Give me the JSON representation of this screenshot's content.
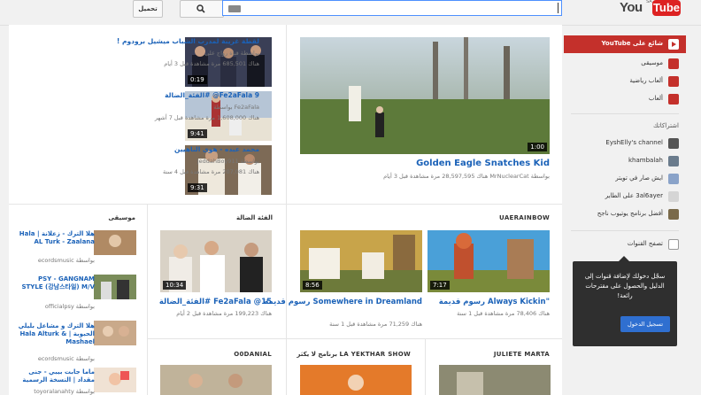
{
  "header": {
    "upload_label": "تحميل",
    "search_value": "",
    "logo_you": "You",
    "logo_tube": "Tube",
    "logo_region": "SA"
  },
  "guide": {
    "featured": "شائع على YouTube",
    "items": [
      "موسيقى",
      "ألعاب رياضية",
      "ألعاب"
    ],
    "subs_heading": "اشتراكاتك",
    "subscriptions": [
      "EyshElly's channel",
      "khambalah",
      "ايش صار في تويتر",
      "3al6ayer على الطاير",
      "أفضل برنامج يوتيوب ناجح"
    ],
    "browse_channels": "تصفح القنوات",
    "promo_text": "سجّل دخولك لإضافة قنوات إلى الدليل والحصول على مقترحات رائعة!",
    "promo_button": "تسجيل الدخول"
  },
  "featured": {
    "title": "Golden Eagle Snatches Kid",
    "meta": "بواسطة MrNuclearCat  هناك 28,597,595 مرة مشاهدة  قبل 3 أيام",
    "duration": "1:00"
  },
  "side_videos": [
    {
      "title": "لقطة غريبة لمدرب الشباب ميشيل برودوم !",
      "by": "بواسطة قناة رواج على",
      "meta": "هناك 685,501 مرة مشاهدة  قبل 3 أيام",
      "duration": "0:19"
    },
    {
      "title": "Fe2aFala 9@ #الفئة_الضالة",
      "by": "Fe2aFala بواسطة",
      "meta": "هناك 1,608,000 مرة مشاهدة  قبل 7 أشهر",
      "duration": "9:41"
    },
    {
      "title": "محمد عبده - هوى الناهيين",
      "by": "بواسطة JeddahBoy911",
      "meta": "هناك 207,081 مرة مشاهدة  قبل 4 سنة",
      "duration": "9:31"
    }
  ],
  "sections": {
    "uaerainbow": {
      "label": "UAERAINBOW",
      "videos": [
        {
          "title": "\"Always Kickin رسوم قديمة",
          "meta": "هناك 78,406 مرة مشاهدة  قبل 1 سنة",
          "duration": "7:17"
        },
        {
          "title": "Somewhere in Dreamland رسوم قديمة",
          "meta": "هناك 71,259 مرة مشاهدة  قبل 1 سنة",
          "duration": "8:56"
        }
      ]
    },
    "fe2a": {
      "label": "الفئة الضالة",
      "video": {
        "title": "15@ Fe2aFala #الفئة_الضالة",
        "meta": "هناك 199,223 مرة مشاهدة  قبل 2 أيام",
        "duration": "10:34"
      }
    },
    "music": {
      "label": "موسيقى",
      "videos": [
        {
          "title": "هلا الترك - زعلانة | Hala AL Turk - Zaalana",
          "by": "بواسطة ecordsmusic",
          "duration": ""
        },
        {
          "title": "PSY - GANGNAM STYLE (강남스타일) M/V",
          "by": "بواسطة officialpsy",
          "duration": ""
        },
        {
          "title": "هلا الترك و مشاعل بليلي الحبوبة | Hala Alturk & Mashael",
          "by": "بواسطة ecordsmusic",
          "duration": ""
        },
        {
          "title": "ماما جابت بيبي - جنى مقداد | النسخة الرسمية",
          "by": "بواسطة toyoralanahty",
          "duration": ""
        }
      ]
    },
    "bottom": [
      "JULIETE MARTA",
      "برنامج لا يكثر LA YEKTHAR SHOW",
      "O0DANIAL"
    ]
  },
  "colors": {
    "link": "#1b62b8",
    "brand": "#c4302b",
    "promo_bg": "#2f2f2f",
    "promo_btn": "#2f6fd0"
  },
  "icons": [
    "search-icon",
    "keyboard-icon",
    "play-icon",
    "music-icon",
    "sports-icon",
    "games-icon",
    "plus-icon",
    "playlist-icon"
  ]
}
